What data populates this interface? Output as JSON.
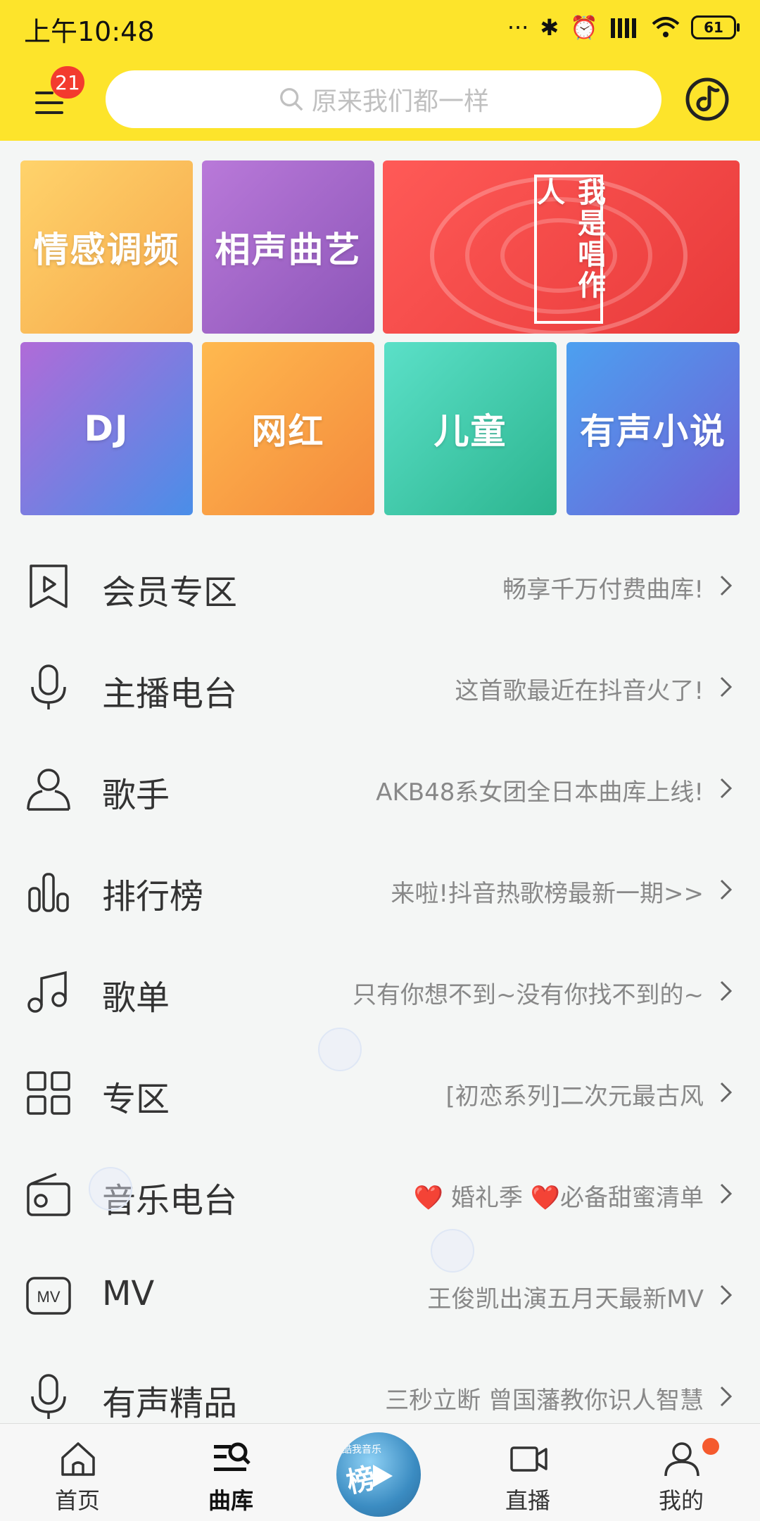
{
  "status": {
    "time": "上午10:48",
    "battery": "61",
    "dots": "···"
  },
  "header": {
    "badge": "21",
    "search_placeholder": "原来我们都一样"
  },
  "tiles": [
    {
      "label": "情感调频",
      "gradient": [
        "#ffd36b",
        "#f6a84b"
      ]
    },
    {
      "label": "相声曲艺",
      "gradient": [
        "#b979d9",
        "#8c55b8"
      ]
    },
    {
      "label": "我是唱作人",
      "gradient": [
        "#ff5a57",
        "#e83a3a"
      ]
    },
    {
      "label": "DJ",
      "gradient": [
        "#b06bd8",
        "#4a8ee8"
      ]
    },
    {
      "label": "网红",
      "gradient": [
        "#ffb94f",
        "#f48a3c"
      ]
    },
    {
      "label": "儿童",
      "gradient": [
        "#5be0c8",
        "#2cb58f"
      ]
    },
    {
      "label": "有声小说",
      "gradient": [
        "#4ca0f0",
        "#6f62d6"
      ]
    }
  ],
  "menu": [
    {
      "title": "会员专区",
      "subtitle": "畅享千万付费曲库!"
    },
    {
      "title": "主播电台",
      "subtitle": "这首歌最近在抖音火了!"
    },
    {
      "title": "歌手",
      "subtitle": "AKB48系女团全日本曲库上线!"
    },
    {
      "title": "排行榜",
      "subtitle": "来啦!抖音热歌榜最新一期>>"
    },
    {
      "title": "歌单",
      "subtitle": "只有你想不到~没有你找不到的~"
    },
    {
      "title": "专区",
      "subtitle": "[初恋系列]二次元最古风"
    },
    {
      "title": "音乐电台",
      "subtitle": "❤️ 婚礼季 ❤️必备甜蜜清单"
    },
    {
      "title": "MV",
      "subtitle": "王俊凯出演五月天最新MV"
    },
    {
      "title": "有声精品",
      "subtitle": "三秒立断 曾国藩教你识人智慧"
    }
  ],
  "tabs": [
    {
      "label": "首页"
    },
    {
      "label": "曲库"
    },
    {
      "label": "直播"
    },
    {
      "label": "我的"
    }
  ],
  "player": {
    "mini_text": "酷我音乐",
    "big_text": "榜"
  },
  "colors": {
    "accent": "#fde42b",
    "badge": "#f33b2e"
  }
}
